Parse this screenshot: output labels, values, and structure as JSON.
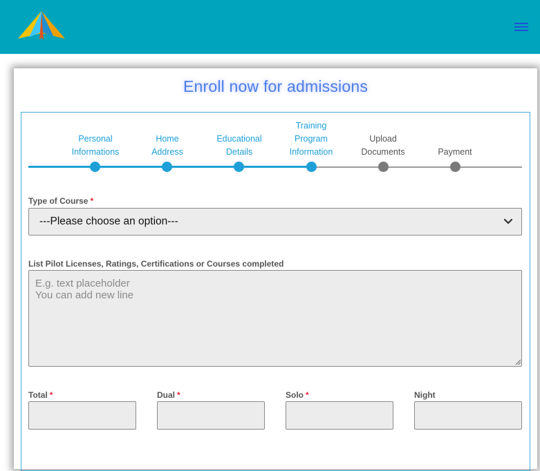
{
  "header": {
    "logo_icon": "paper-plane-logo",
    "menu_icon": "hamburger-menu-icon",
    "background_color": "#00a5bd"
  },
  "page": {
    "title": "Enroll now for admissions"
  },
  "steps": [
    {
      "label_lines": [
        "Personal",
        "Informations"
      ],
      "state": "complete"
    },
    {
      "label_lines": [
        "Home",
        "Address"
      ],
      "state": "complete"
    },
    {
      "label_lines": [
        "Educational",
        "Details"
      ],
      "state": "complete"
    },
    {
      "label_lines": [
        "Training",
        "Program",
        "Information"
      ],
      "state": "current"
    },
    {
      "label_lines": [
        "Upload",
        "Documents"
      ],
      "state": "pending"
    },
    {
      "label_lines": [
        "Payment"
      ],
      "state": "pending"
    }
  ],
  "form": {
    "course": {
      "label": "Type of Course",
      "required_mark": "*",
      "selected": "---Please choose an option---"
    },
    "licenses": {
      "label": "List Pilot Licenses, Ratings, Certifications or Courses completed",
      "placeholder": "E.g. text placeholder\nYou can add new line",
      "value": ""
    },
    "hours": [
      {
        "label": "Total",
        "required_mark": "*",
        "value": ""
      },
      {
        "label": "Dual",
        "required_mark": "*",
        "value": ""
      },
      {
        "label": "Solo",
        "required_mark": "*",
        "value": ""
      },
      {
        "label": "Night",
        "required_mark": "",
        "value": ""
      }
    ]
  },
  "colors": {
    "accent": "#1e9fd8",
    "title": "#4d7fe8",
    "required": "#e0243a",
    "pending": "#7a7a7a"
  }
}
